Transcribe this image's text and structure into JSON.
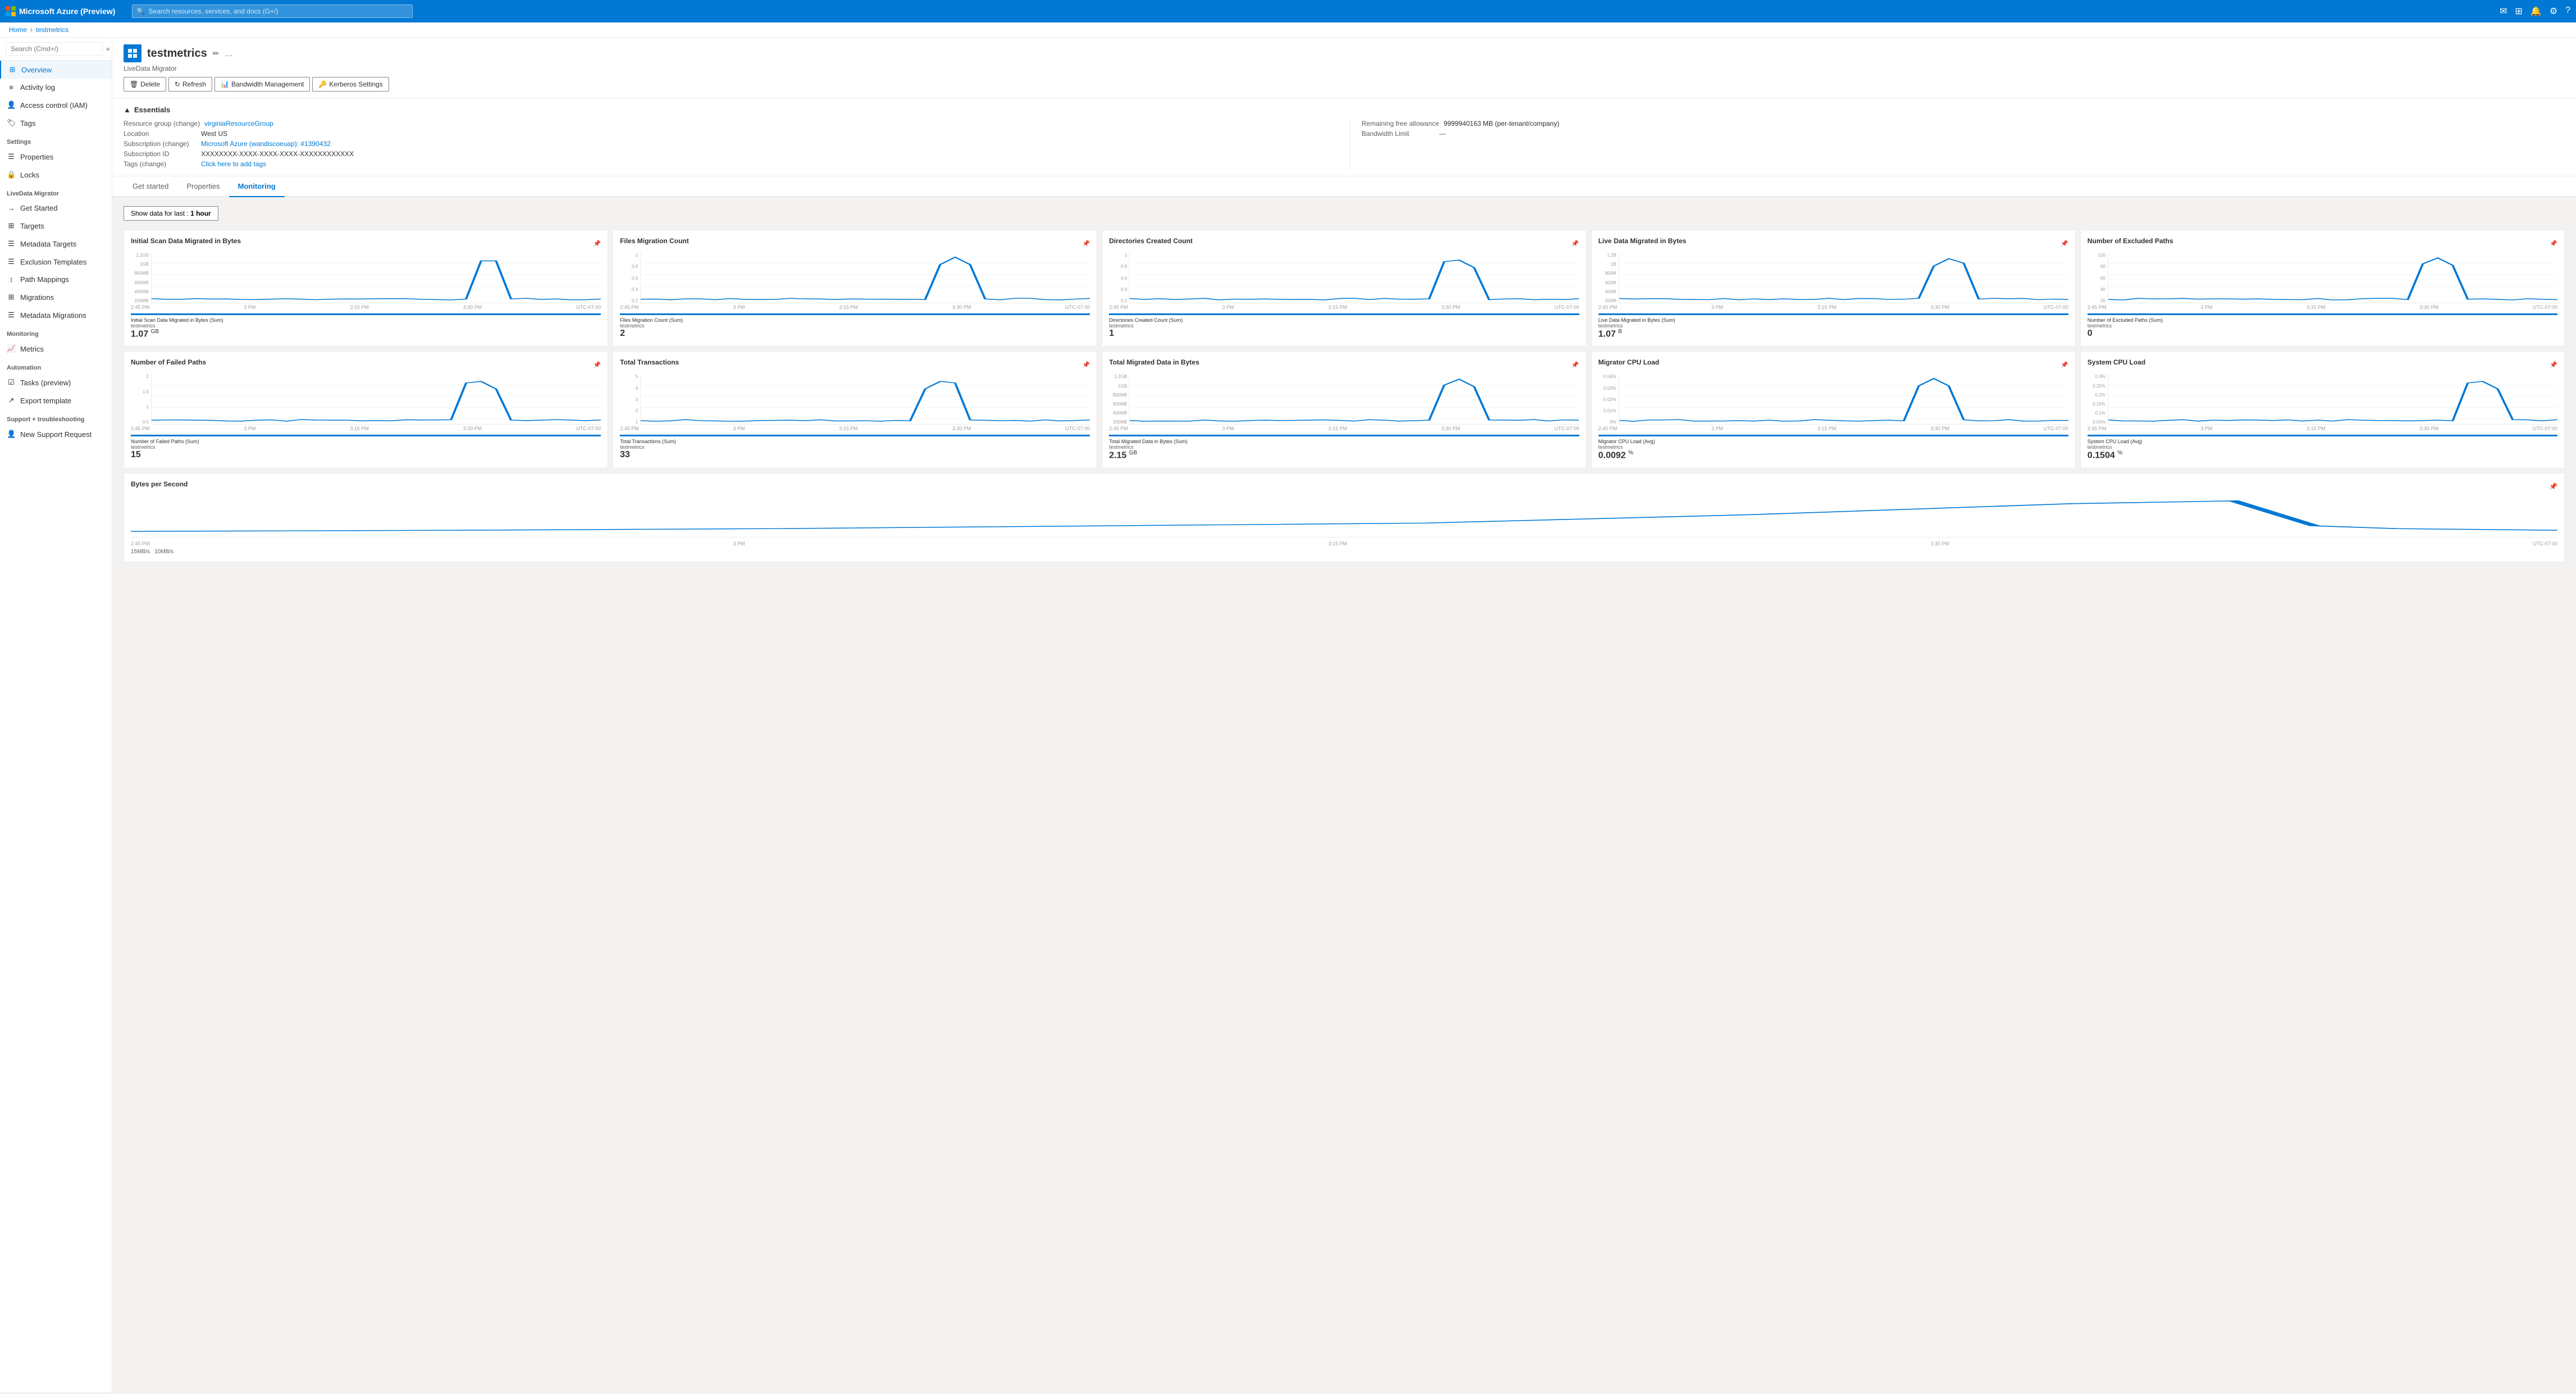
{
  "topbar": {
    "app_name": "Microsoft Azure (Preview)",
    "search_placeholder": "Search resources, services, and docs (G+/)"
  },
  "breadcrumb": {
    "home": "Home",
    "current": "testmetrics"
  },
  "resource": {
    "name": "testmetrics",
    "subtitle": "LiveData Migrator",
    "edit_icon": "✏",
    "more_icon": "…"
  },
  "actions": {
    "delete": "Delete",
    "refresh": "Refresh",
    "bandwidth": "Bandwidth Management",
    "kerberos": "Kerberos Settings"
  },
  "essentials": {
    "title": "Essentials",
    "resource_group_label": "Resource group (change)",
    "resource_group_value": "virginiaResourceGroup",
    "location_label": "Location",
    "location_value": "West US",
    "subscription_label": "Subscription (change)",
    "subscription_value": "Microsoft Azure (wandiscoeuap): #1390432",
    "subscription_id_label": "Subscription ID",
    "subscription_id_value": "XXXXXXXX-XXXX-XXXX-XXXX-XXXXXXXXXXXX",
    "tags_label": "Tags (change)",
    "tags_value": "Click here to add tags",
    "remaining_label": "Remaining free allowance",
    "remaining_value": "9999940163 MB (per-tenant/company)",
    "bandwidth_label": "Bandwidth Limit",
    "bandwidth_value": "---"
  },
  "tabs": [
    "Get started",
    "Properties",
    "Monitoring"
  ],
  "active_tab": 2,
  "data_range": {
    "label": "Show data for last :",
    "value": "1 hour"
  },
  "sidebar": {
    "search_placeholder": "Search (Cmd+/)",
    "items": [
      {
        "label": "Overview",
        "icon": "⊞",
        "active": true,
        "section": null
      },
      {
        "label": "Activity log",
        "icon": "≡",
        "active": false,
        "section": null
      },
      {
        "label": "Access control (IAM)",
        "icon": "👤",
        "active": false,
        "section": null
      },
      {
        "label": "Tags",
        "icon": "🏷",
        "active": false,
        "section": null
      },
      {
        "label": "Settings",
        "icon": null,
        "active": false,
        "section": "Settings"
      },
      {
        "label": "Properties",
        "icon": "☰",
        "active": false,
        "section": null
      },
      {
        "label": "Locks",
        "icon": "🔒",
        "active": false,
        "section": null
      },
      {
        "label": "LiveData Migrator",
        "icon": null,
        "active": false,
        "section": "LiveData Migrator"
      },
      {
        "label": "Get Started",
        "icon": "→",
        "active": false,
        "section": null
      },
      {
        "label": "Targets",
        "icon": "⊞",
        "active": false,
        "section": null
      },
      {
        "label": "Metadata Targets",
        "icon": "☰",
        "active": false,
        "section": null
      },
      {
        "label": "Exclusion Templates",
        "icon": "☰",
        "active": false,
        "section": null
      },
      {
        "label": "Path Mappings",
        "icon": "↕",
        "active": false,
        "section": null
      },
      {
        "label": "Migrations",
        "icon": "⊞",
        "active": false,
        "section": null
      },
      {
        "label": "Metadata Migrations",
        "icon": "☰",
        "active": false,
        "section": null
      },
      {
        "label": "Monitoring",
        "icon": null,
        "active": false,
        "section": "Monitoring"
      },
      {
        "label": "Metrics",
        "icon": "📈",
        "active": false,
        "section": null
      },
      {
        "label": "Automation",
        "icon": null,
        "active": false,
        "section": "Automation"
      },
      {
        "label": "Tasks (preview)",
        "icon": "☑",
        "active": false,
        "section": null
      },
      {
        "label": "Export template",
        "icon": "↗",
        "active": false,
        "section": null
      },
      {
        "label": "Support + troubleshooting",
        "icon": null,
        "active": false,
        "section": "Support + troubleshooting"
      },
      {
        "label": "New Support Request",
        "icon": "👤",
        "active": false,
        "section": null
      }
    ]
  },
  "charts_row1": [
    {
      "title": "Initial Scan Data Migrated in Bytes",
      "y_labels": [
        "1.2GB",
        "1GB",
        "800MB",
        "600MB",
        "400MB",
        "200MB"
      ],
      "x_labels": [
        "2:45 PM",
        "3 PM",
        "3:15 PM",
        "3:30 PM",
        "UTC-07:00"
      ],
      "metric_label": "Initial Scan Data Migrated in Bytes (Sum)",
      "metric_sub": "testmetrics",
      "value": "1.07",
      "unit": "GB",
      "has_spike": true,
      "spike_pos": 0.75
    },
    {
      "title": "Files Migration Count",
      "y_labels": [
        "1",
        "0.8",
        "0.6",
        "0.4",
        "0.2"
      ],
      "x_labels": [
        "2:45 PM",
        "3 PM",
        "3:15 PM",
        "3:30 PM",
        "UTC-07:00"
      ],
      "metric_label": "Files Migration Count (Sum)",
      "metric_sub": "testmetrics",
      "value": "2",
      "unit": "",
      "has_spike": true,
      "spike_pos": 0.7
    },
    {
      "title": "Directories Created Count",
      "y_labels": [
        "1",
        "0.8",
        "0.6",
        "0.4",
        "0.2"
      ],
      "x_labels": [
        "2:45 PM",
        "3 PM",
        "3:15 PM",
        "3:30 PM",
        "UTC-07:00"
      ],
      "metric_label": "Directories Created Count (Sum)",
      "metric_sub": "testmetrics",
      "value": "1",
      "unit": "",
      "has_spike": true,
      "spike_pos": 0.72
    },
    {
      "title": "Live Data Migrated in Bytes",
      "y_labels": [
        "1.2B",
        "1B",
        "800M",
        "600M",
        "400M",
        "200M"
      ],
      "x_labels": [
        "2:45 PM",
        "3 PM",
        "3:15 PM",
        "3:30 PM",
        "UTC-07:00"
      ],
      "metric_label": "Live Data Migrated in Bytes (Sum)",
      "metric_sub": "testmetrics",
      "value": "1.07",
      "unit": "B",
      "has_spike": true,
      "spike_pos": 0.74
    },
    {
      "title": "Number of Excluded Paths",
      "y_labels": [
        "100",
        "80",
        "60",
        "40",
        "20"
      ],
      "x_labels": [
        "2:45 PM",
        "3 PM",
        "3:15 PM",
        "3:30 PM",
        "UTC-07:00"
      ],
      "metric_label": "Number of Excluded Paths (Sum)",
      "metric_sub": "testmetrics",
      "value": "0",
      "unit": "",
      "has_spike": true,
      "spike_pos": 0.73
    }
  ],
  "charts_row2": [
    {
      "title": "Number of Failed Paths",
      "y_labels": [
        "2",
        "1.5",
        "1",
        "0.5"
      ],
      "x_labels": [
        "2:45 PM",
        "3 PM",
        "3:15 PM",
        "3:30 PM",
        "UTC-07:00"
      ],
      "metric_label": "Number of Failed Paths (Sum)",
      "metric_sub": "testmetrics",
      "value": "15",
      "unit": "",
      "has_spike": true,
      "spike_pos": 0.72
    },
    {
      "title": "Total Transactions",
      "y_labels": [
        "5",
        "4",
        "3",
        "2",
        "1"
      ],
      "x_labels": [
        "2:45 PM",
        "3 PM",
        "3:15 PM",
        "3:30 PM",
        "UTC-07:00"
      ],
      "metric_label": "Total Transactions (Sum)",
      "metric_sub": "testmetrics",
      "value": "33",
      "unit": "",
      "has_spike": true,
      "spike_pos": 0.68
    },
    {
      "title": "Total Migrated Data in Bytes",
      "y_labels": [
        "1.2GB",
        "1GB",
        "800MB",
        "600MB",
        "400MB",
        "200MB"
      ],
      "x_labels": [
        "2:45 PM",
        "3 PM",
        "3:15 PM",
        "3:30 PM",
        "UTC-07:00"
      ],
      "metric_label": "Total Migrated Data in Bytes (Sum)",
      "metric_sub": "testmetrics",
      "value": "2.15",
      "unit": "GB",
      "has_spike": true,
      "spike_pos": 0.73
    },
    {
      "title": "Migrator CPU Load",
      "y_labels": [
        "0.04%",
        "0.03%",
        "0.02%",
        "0.01%",
        "0%"
      ],
      "x_labels": [
        "2:45 PM",
        "3 PM",
        "3:15 PM",
        "3:30 PM",
        "UTC-07:00"
      ],
      "metric_label": "Migrator CPU Load (Avg)",
      "metric_sub": "testmetrics",
      "value": "0.0092",
      "unit": "%",
      "has_spike": true,
      "spike_pos": 0.7
    },
    {
      "title": "System CPU Load",
      "y_labels": [
        "0.3%",
        "0.25%",
        "0.2%",
        "0.15%",
        "0.1%",
        "0.05%"
      ],
      "x_labels": [
        "2:45 PM",
        "3 PM",
        "3:15 PM",
        "3:30 PM",
        "UTC-07:00"
      ],
      "metric_label": "System CPU Load (Avg)",
      "metric_sub": "testmetrics",
      "value": "0.1504",
      "unit": "%",
      "has_spike": true,
      "spike_pos": 0.82
    }
  ],
  "chart_bytes_per_sec": {
    "title": "Bytes per Second",
    "y_labels": [
      "15MB/s",
      "10MB/s"
    ],
    "x_labels": [
      "2:45 PM",
      "3 PM",
      "3:15 PM",
      "3:30 PM",
      "UTC-07:00"
    ]
  }
}
